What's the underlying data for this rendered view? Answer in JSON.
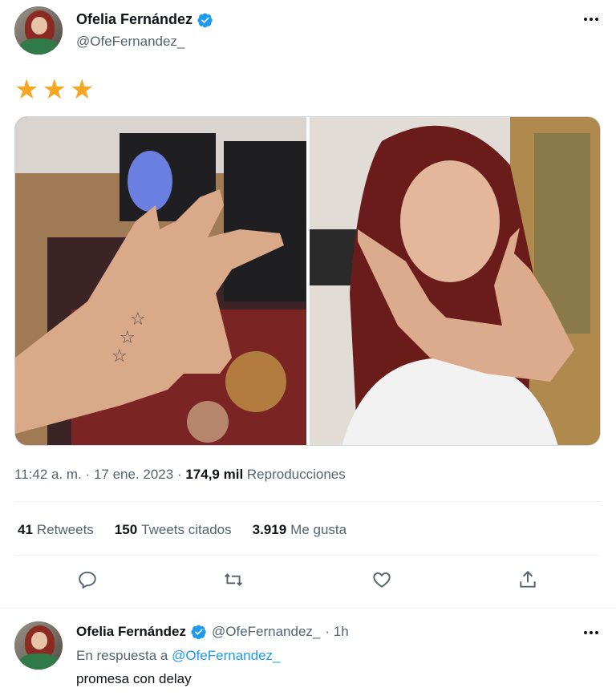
{
  "tweet": {
    "author": {
      "display_name": "Ofelia Fernández",
      "handle": "@OfeFernandez_",
      "verified": true,
      "avatar": "avatar"
    },
    "text": "★★★",
    "media": [
      {
        "alt": "",
        "kind": "photo"
      },
      {
        "alt": "",
        "kind": "photo"
      }
    ],
    "meta": {
      "time": "11:42 a. m.",
      "separator": "·",
      "date": "17 ene. 2023",
      "views_count": "174,9 mil",
      "views_label": "Reproducciones"
    },
    "stats": {
      "retweets_count": "41",
      "retweets_label": "Retweets",
      "quotes_count": "150",
      "quotes_label": "Tweets citados",
      "likes_count": "3.919",
      "likes_label": "Me gusta"
    },
    "actions": [
      "reply-icon",
      "retweet-icon",
      "like-icon",
      "share-icon"
    ]
  },
  "reply": {
    "display_name": "Ofelia Fernández",
    "handle": "@OfeFernandez_",
    "time": "· 1h",
    "reply_prefix": "En respuesta a",
    "reply_to": "@OfeFernandez_",
    "text": "promesa con delay"
  },
  "colors": {
    "accent": "#1d9bf0",
    "star": "#f5a623",
    "text": "#0f1419",
    "muted": "#536471"
  }
}
